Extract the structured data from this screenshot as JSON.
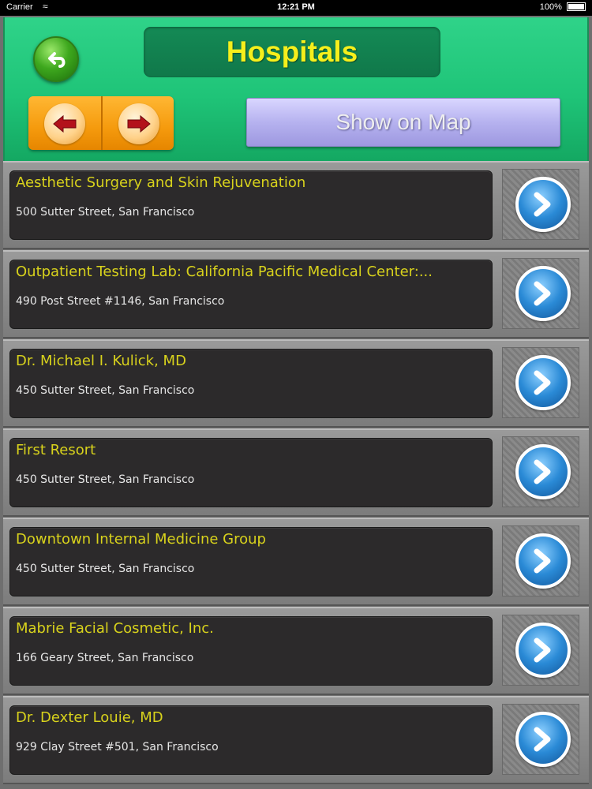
{
  "status_bar": {
    "carrier": "Carrier",
    "time": "12:21 PM",
    "battery": "100%"
  },
  "header": {
    "title": "Hospitals",
    "show_on_map_label": "Show on Map"
  },
  "icons": {
    "back": "back-arrow-icon",
    "prev": "left-arrow-icon",
    "next": "right-arrow-icon",
    "detail": "chevron-right-icon"
  },
  "colors": {
    "header_green": "#1fc478",
    "title_yellow": "#f5ef1c",
    "row_title_yellow": "#d8d21c",
    "detail_blue": "#2a8ad6"
  },
  "items": [
    {
      "name": "Aesthetic Surgery and Skin Rejuvenation",
      "address": "500 Sutter Street, San Francisco"
    },
    {
      "name": "Outpatient Testing Lab: California Pacific Medical Center:...",
      "address": "490 Post Street #1146, San Francisco"
    },
    {
      "name": "Dr. Michael I. Kulick, MD",
      "address": "450 Sutter Street, San Francisco"
    },
    {
      "name": "First Resort",
      "address": "450 Sutter Street, San Francisco"
    },
    {
      "name": "Downtown Internal Medicine Group",
      "address": "450 Sutter Street, San Francisco"
    },
    {
      "name": "Mabrie Facial Cosmetic, Inc.",
      "address": "166 Geary Street, San Francisco"
    },
    {
      "name": "Dr. Dexter Louie, MD",
      "address": "929 Clay Street #501, San Francisco"
    }
  ]
}
